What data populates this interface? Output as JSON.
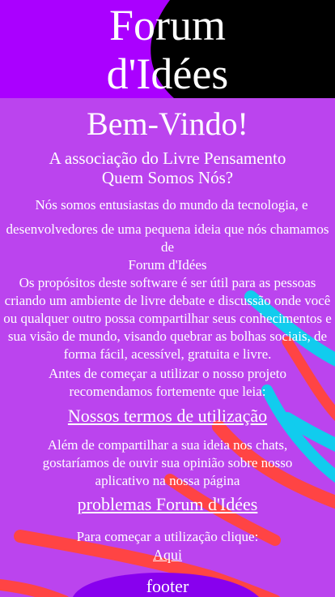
{
  "header": {
    "title_line1": "Forum",
    "title_line2": "d'Idées"
  },
  "main": {
    "welcome": "Bem-Vindo!",
    "association": "A associação do Livre Pensamento",
    "who_we_are": "Quem Somos Nós?",
    "intro_line1": "Nós somos entusiastas do mundo da tecnologia, e",
    "intro_line2": "desenvolvedores de uma pequena ideia que nós chamamos de",
    "intro_name": "Forum d'Idées",
    "purpose": "Os propósitos deste software é ser útil para as pessoas criando um ambiente de livre debate e discussão onde você ou qualquer outro possa compartilhar seus conhecimentos e sua visão de mundo, visando quebrar as bolhas sociais, de forma fácil, acessível, gratuita e livre.",
    "before_use": "Antes de começar a utilizar o nosso projeto recomendamos fortemente que leia:",
    "terms_link": "Nossos termos de utilização",
    "feedback": "Além de compartilhar a sua ideia nos chats, gostaríamos de ouvir sua opinião sobre nosso aplicativo na nossa página",
    "problems_link": "problemas Forum d'Idées",
    "start_prompt": "Para começar a utilização clique:",
    "here_link": "Aqui"
  },
  "footer": {
    "label": "footer"
  },
  "colors": {
    "background": "#bb44ee",
    "header_purple": "#aa00ff",
    "header_black": "#000000",
    "stripe_blue": "#11ccee",
    "stripe_red": "#ff4444",
    "blob_purple": "#8800ee"
  }
}
